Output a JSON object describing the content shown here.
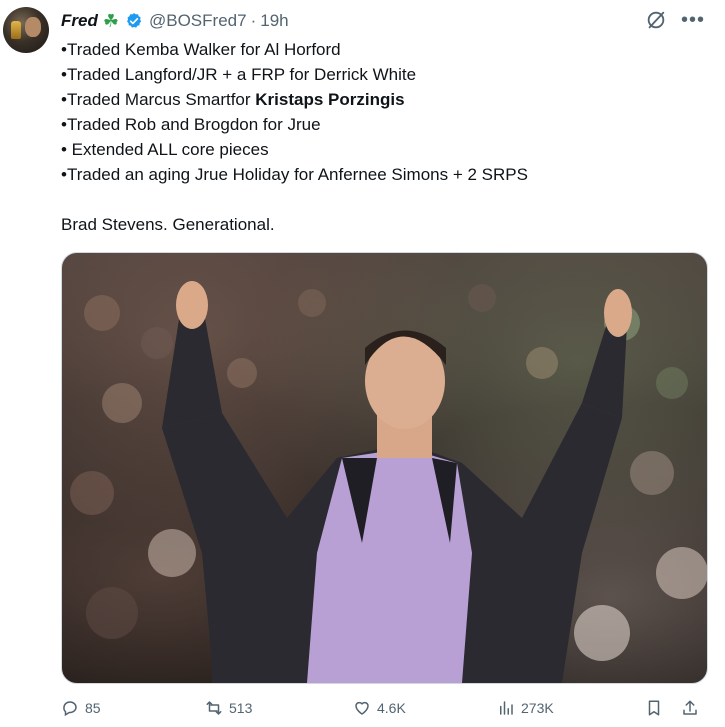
{
  "tweet": {
    "display_name": "Fred",
    "clover_emoji": "☘",
    "handle": "@BOSFred7",
    "separator": "·",
    "time": "19h",
    "lines": [
      "•Traded Kemba Walker for Al Horford",
      "•Traded Langford/JR + a FRP for Derrick White",
      "•Traded Marcus Smartfor ",
      "•Traded Rob and Brogdon for Jrue",
      "• Extended ALL core pieces",
      "•Traded an aging Jrue Holiday for Anfernee Simons + 2 SRPS"
    ],
    "bold_name": "Kristaps Porzingis",
    "closing": "Brad Stevens. Generational."
  },
  "actions": {
    "replies": "85",
    "reposts": "513",
    "likes": "4.6K",
    "views": "273K"
  },
  "icons": {
    "header": [
      "verified-badge-icon",
      "grok-icon",
      "more-icon"
    ],
    "actions": [
      "reply-icon",
      "repost-icon",
      "like-icon",
      "views-icon",
      "bookmark-icon",
      "share-icon"
    ]
  },
  "colors": {
    "verified": "#1d9bf0",
    "secondary_text": "#536471",
    "clover": "#2e9e4a"
  }
}
